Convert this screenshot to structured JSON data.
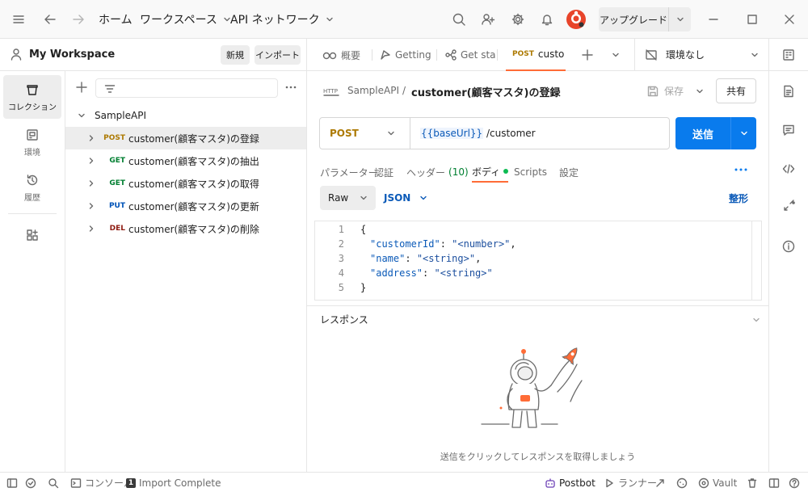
{
  "titlebar": {
    "home": "ホーム",
    "workspaces": "ワークスペース",
    "api_network": "API ネットワーク",
    "upgrade": "アップグレード"
  },
  "workspace": {
    "name": "My Workspace",
    "new_button": "新規",
    "import_button": "インポート"
  },
  "rail": {
    "items": [
      {
        "label": "コレクション",
        "icon": "collections-icon"
      },
      {
        "label": "環境",
        "icon": "environment-icon"
      },
      {
        "label": "履歴",
        "icon": "history-icon"
      },
      {
        "label": "",
        "icon": "configure-workbench-icon"
      }
    ]
  },
  "tree": {
    "collection": "SampleAPI",
    "requests": [
      {
        "method": "POST",
        "name": "customer(顧客マスタ)の登録",
        "color": "#ad7a03"
      },
      {
        "method": "GET",
        "name": "customer(顧客マスタ)の抽出",
        "color": "#007f31"
      },
      {
        "method": "GET",
        "name": "customer(顧客マスタ)の取得",
        "color": "#007f31"
      },
      {
        "method": "PUT",
        "name": "customer(顧客マスタ)の更新",
        "color": "#0053b8"
      },
      {
        "method": "DEL",
        "name": "customer(顧客マスタ)の削除",
        "color": "#8e1a10"
      }
    ]
  },
  "tabs": [
    {
      "label": "概要"
    },
    {
      "label": "Getting"
    },
    {
      "label": "Get sta"
    },
    {
      "method": "POST",
      "label": "custo"
    }
  ],
  "environment": "環境なし",
  "request": {
    "breadcrumb_parent": "SampleAPI",
    "breadcrumb_sep": "/",
    "title": "customer(顧客マスタ)の登録",
    "save": "保存",
    "share": "共有",
    "method": "POST",
    "url_variable": "{{baseUrl}}",
    "url_path": " /customer",
    "send": "送信"
  },
  "subtabs": {
    "params": "パラメーター",
    "auth": "認証",
    "headers": "ヘッダー",
    "headers_count": "(10)",
    "body": "ボディ",
    "scripts": "Scripts",
    "settings": "設定"
  },
  "body_options": {
    "raw": "Raw",
    "json": "JSON",
    "beautify": "整形"
  },
  "editor": {
    "line_numbers": [
      "1",
      "2",
      "3",
      "4",
      "5"
    ],
    "lines": [
      {
        "open": "{"
      },
      {
        "key": "\"customerId\"",
        "colon": ": ",
        "value": "\"<number>\"",
        "comma": ","
      },
      {
        "key": "\"name\"",
        "colon": ": ",
        "value": "\"<string>\"",
        "comma": ","
      },
      {
        "key": "\"address\"",
        "colon": ": ",
        "value": "\"<string>\"",
        "comma": ""
      },
      {
        "close": "}"
      }
    ]
  },
  "response": {
    "title": "レスポンス",
    "hint": "送信をクリックしてレスポンスを取得しましょう"
  },
  "statusbar": {
    "console": "コンソール",
    "import_badge": "1",
    "import_status": "Import Complete",
    "postbot": "Postbot",
    "runner": "ランナー",
    "vault": "Vault"
  },
  "colors": {
    "accent": "#ff6c37",
    "send_button": "#097bed",
    "post": "#ad7a03",
    "get": "#007f31",
    "put": "#0053b8",
    "delete": "#8e1a10",
    "body_dot": "#0cbb52"
  }
}
